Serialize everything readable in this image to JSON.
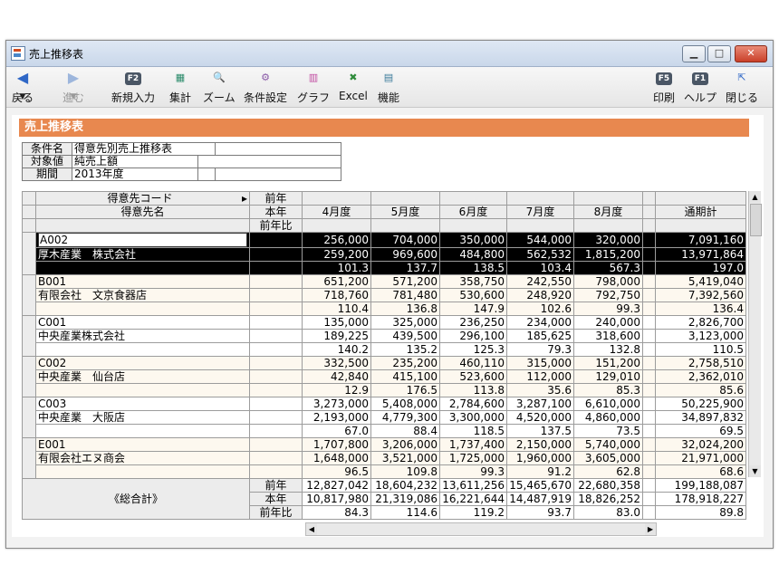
{
  "window": {
    "title": "売上推移表"
  },
  "toolbar": {
    "back": "戻る",
    "forward": "進む",
    "new_entry": {
      "key": "F2",
      "label": "新規入力"
    },
    "aggregate": "集計",
    "zoom": "ズーム",
    "condition": "条件設定",
    "graph": "グラフ",
    "excel": "Excel",
    "function": "機能",
    "print": {
      "key": "F5",
      "label": "印刷"
    },
    "help": {
      "key": "F1",
      "label": "ヘルプ"
    },
    "close": "閉じる"
  },
  "report": {
    "heading": "売上推移表",
    "conditions": [
      {
        "key": "条件名",
        "value": "得意先別売上推移表"
      },
      {
        "key": "対象値",
        "value": "純売上額"
      },
      {
        "key": "期間",
        "value": "2013年度"
      }
    ],
    "header": {
      "code_col": "得意先コード",
      "name_col": "得意先名",
      "sort_arrow": "▸",
      "metric_prev": "前年",
      "metric_curr": "本年",
      "metric_ratio": "前年比",
      "months": [
        "4月度",
        "5月度",
        "6月度",
        "7月度",
        "8月度"
      ],
      "total": "通期計"
    },
    "customers": [
      {
        "code": "A002",
        "name": "厚木産業　株式会社",
        "prev": [
          "256,000",
          "704,000",
          "350,000",
          "544,000",
          "320,000",
          "",
          "7,091,160"
        ],
        "curr": [
          "259,200",
          "969,600",
          "484,800",
          "562,532",
          "1,815,200",
          "",
          "13,971,864"
        ],
        "ratio": [
          "101.3",
          "137.7",
          "138.5",
          "103.4",
          "567.3",
          "",
          "197.0"
        ]
      },
      {
        "code": "B001",
        "name": "有限会社　文京食器店",
        "prev": [
          "651,200",
          "571,200",
          "358,750",
          "242,550",
          "798,000",
          "",
          "5,419,040"
        ],
        "curr": [
          "718,760",
          "781,480",
          "530,600",
          "248,920",
          "792,750",
          "",
          "7,392,560"
        ],
        "ratio": [
          "110.4",
          "136.8",
          "147.9",
          "102.6",
          "99.3",
          "",
          "136.4"
        ]
      },
      {
        "code": "C001",
        "name": "中央産業株式会社",
        "prev": [
          "135,000",
          "325,000",
          "236,250",
          "234,000",
          "240,000",
          "",
          "2,826,700"
        ],
        "curr": [
          "189,225",
          "439,500",
          "296,100",
          "185,625",
          "318,600",
          "",
          "3,123,000"
        ],
        "ratio": [
          "140.2",
          "135.2",
          "125.3",
          "79.3",
          "132.8",
          "",
          "110.5"
        ]
      },
      {
        "code": "C002",
        "name": "中央産業　仙台店",
        "prev": [
          "332,500",
          "235,200",
          "460,110",
          "315,000",
          "151,200",
          "",
          "2,758,510"
        ],
        "curr": [
          "42,840",
          "415,100",
          "523,600",
          "112,000",
          "129,010",
          "",
          "2,362,010"
        ],
        "ratio": [
          "12.9",
          "176.5",
          "113.8",
          "35.6",
          "85.3",
          "",
          "85.6"
        ]
      },
      {
        "code": "C003",
        "name": "中央産業　大阪店",
        "prev": [
          "3,273,000",
          "5,408,000",
          "2,784,600",
          "3,287,100",
          "6,610,000",
          "",
          "50,225,900"
        ],
        "curr": [
          "2,193,000",
          "4,779,300",
          "3,300,000",
          "4,520,000",
          "4,860,000",
          "",
          "34,897,832"
        ],
        "ratio": [
          "67.0",
          "88.4",
          "118.5",
          "137.5",
          "73.5",
          "",
          "69.5"
        ]
      },
      {
        "code": "E001",
        "name": "有限会社エヌ商会",
        "prev": [
          "1,707,800",
          "3,206,000",
          "1,737,400",
          "2,150,000",
          "5,740,000",
          "",
          "32,024,200"
        ],
        "curr": [
          "1,648,000",
          "3,521,000",
          "1,725,000",
          "1,960,000",
          "3,605,000",
          "",
          "21,971,000"
        ],
        "ratio": [
          "96.5",
          "109.8",
          "99.3",
          "91.2",
          "62.8",
          "",
          "68.6"
        ]
      }
    ],
    "grand_total": {
      "label": "《総合計》",
      "prev": [
        "12,827,042",
        "18,604,232",
        "13,611,256",
        "15,465,670",
        "22,680,358",
        "",
        "199,188,087"
      ],
      "curr": [
        "10,817,980",
        "21,319,086",
        "16,221,644",
        "14,487,919",
        "18,826,252",
        "",
        "178,918,227"
      ],
      "ratio": [
        "84.3",
        "114.6",
        "119.2",
        "93.7",
        "83.0",
        "",
        "89.8"
      ]
    }
  }
}
